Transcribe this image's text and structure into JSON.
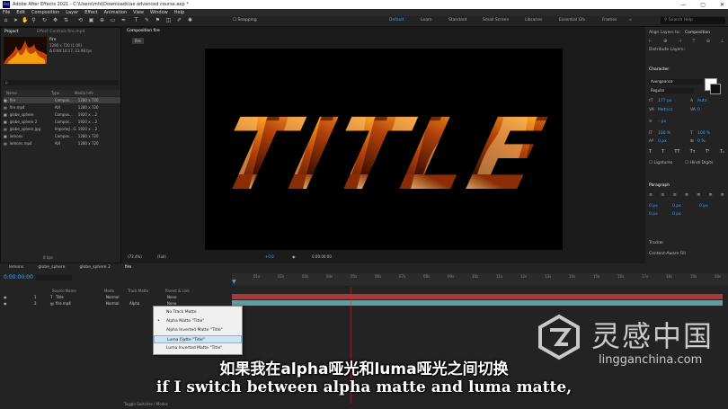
{
  "window": {
    "title": "Adobe After Effects 2021 - C:\\Users\\mfx\\Downloads\\ae advanced course.aep *",
    "app_badge": "Ae",
    "buttons": {
      "minimize": "—",
      "maximize": "▢",
      "close": "✕"
    }
  },
  "menu": [
    "File",
    "Edit",
    "Composition",
    "Layer",
    "Effect",
    "Animation",
    "View",
    "Window",
    "Help"
  ],
  "toolbar": {
    "snapping_label": "Snapping",
    "workspaces": [
      "Default",
      "Learn",
      "Standard",
      "Small Screen",
      "Libraries",
      "Essential Gfx",
      "Frames"
    ],
    "active_workspace": "Default",
    "search_placeholder": "Search Help"
  },
  "project_panel": {
    "tab": "Project",
    "effect_tab": "Effect Controls fire.mp4",
    "selected_name": "fire",
    "selected_info1": "1280 x 720 (1.00)",
    "selected_info2": "Δ 0:00:10:17, 23.98 fps",
    "search_placeholder": "ρ",
    "columns": [
      "Name",
      "Type",
      "Media Info"
    ],
    "items": [
      {
        "name": "fire",
        "type": "Compos...",
        "info": "1280 x 720"
      },
      {
        "name": "fire.mp4",
        "type": "AVI",
        "info": "1280 x 720"
      },
      {
        "name": "globe_sphere",
        "type": "Compos...",
        "info": "1920 x ...2"
      },
      {
        "name": "globe_sphere 2",
        "type": "Compos...",
        "info": "1920 x ...2"
      },
      {
        "name": "globe_sphere.jpg",
        "type": "ImporteJ...G",
        "info": "1920 x ...2"
      },
      {
        "name": "lemons",
        "type": "Compos...",
        "info": "1280 x 720"
      },
      {
        "name": "lemons.mp4",
        "type": "AVI",
        "info": "1280 x 720"
      }
    ],
    "footer_bpc": "8 bpc"
  },
  "composition": {
    "tab": "Composition fire",
    "breadcrumb": "fire",
    "title_text": "TITLE",
    "zoom": "(73.4%)",
    "resolution": "(Full)",
    "timecode": "0:00:00:00",
    "exposure": "+0.0"
  },
  "right_panel": {
    "align_tab": "Align Layers to:",
    "align_target": "Composition",
    "distribute_label": "Distribute Layers:",
    "character_title": "Character",
    "font_family": "Avengeance",
    "font_style": "Regular",
    "font_size": "177 px",
    "leading": "Auto",
    "kerning": "Metrics",
    "tracking": "0",
    "stroke_width": "– px",
    "v_scale": "100 %",
    "h_scale": "100 %",
    "baseline": "0 px",
    "tsume": "0 %",
    "ligatures_label": "Ligatures",
    "hindi_label": "Hindi Digits",
    "paragraph_title": "Paragraph",
    "indent_values": [
      "0 px",
      "0 px",
      "0 px",
      "0 px",
      "0 px"
    ],
    "tracker_title": "Tracker",
    "content_aware_title": "Content-Aware Fill"
  },
  "timeline": {
    "tabs": [
      "lemons",
      "globe_sphere",
      "globe_sphere 2",
      "fire"
    ],
    "active_tab": "fire",
    "timecode": "0:00:00:00",
    "columns": {
      "source_name": "Source Name",
      "mode": "Mode",
      "trkmat": "Track Matte",
      "parent": "Parent & Link"
    },
    "layers": [
      {
        "num": "1",
        "name": "Title",
        "mode": "Normal",
        "trkmat": "",
        "parent": "None"
      },
      {
        "num": "2",
        "name": "fire.mp4",
        "mode": "Normal",
        "trkmat": "Alpha",
        "parent": "None"
      }
    ],
    "ruler_ticks": [
      "01s",
      "02s",
      "03s",
      "04s",
      "05s",
      "06s",
      "07s",
      "08s",
      "09s",
      "10s",
      "11s",
      "12s",
      "13s",
      "14s",
      "15s",
      "16s",
      "17s",
      "18s",
      "19s",
      "20s"
    ],
    "footer": "Toggle Switches / Modes"
  },
  "track_matte_menu": {
    "items": [
      "No Track Matte",
      "Alpha Matte \"Title\"",
      "Alpha Inverted Matte \"Title\"",
      "Luma Matte \"Title\"",
      "Luma Inverted Matte \"Title\""
    ],
    "checked_index": 1,
    "highlighted_index": 3
  },
  "subtitles": {
    "zh": "如果我在alpha哑光和luma哑光之间切换",
    "en": "if I switch between alpha matte and luma matte,"
  },
  "watermark": {
    "name": "灵感中国",
    "url": "lingganchina.com"
  },
  "colors": {
    "accent": "#4a9ff5",
    "fire": "#f08a1c",
    "title_track": "#c04040",
    "fire_track": "#5f9ea0"
  }
}
